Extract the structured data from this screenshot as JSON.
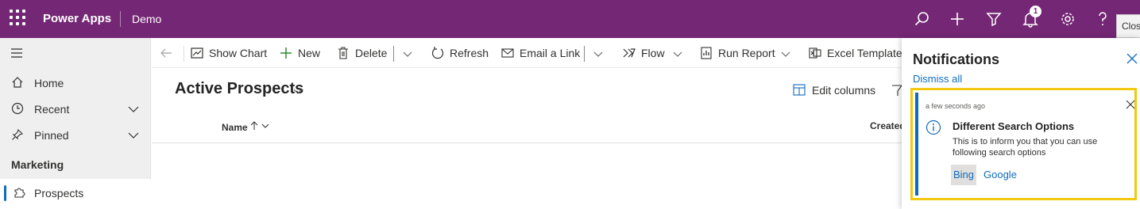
{
  "topbar": {
    "app_name": "Power Apps",
    "environment": "Demo",
    "notification_count": "1",
    "close_tooltip": "Clos",
    "icons": [
      "search-icon",
      "plus-icon",
      "filter-icon",
      "bell-icon",
      "gear-icon",
      "help-icon"
    ],
    "background_color": "#742774"
  },
  "sidebar": {
    "items": [
      {
        "label": "Home",
        "icon": "home-icon"
      },
      {
        "label": "Recent",
        "icon": "clock-icon",
        "expandable": true
      },
      {
        "label": "Pinned",
        "icon": "pin-icon",
        "expandable": true
      }
    ],
    "group_label": "Marketing",
    "active_item": {
      "label": "Prospects",
      "icon": "puzzle-icon"
    }
  },
  "commandbar": {
    "show_chart": "Show Chart",
    "new": "New",
    "delete": "Delete",
    "refresh": "Refresh",
    "email_link": "Email a Link",
    "flow": "Flow",
    "run_report": "Run Report",
    "excel_templates": "Excel Templates"
  },
  "view": {
    "title": "Active Prospects",
    "edit_columns": "Edit columns",
    "columns": {
      "name": "Name",
      "created": "Created"
    }
  },
  "notifications": {
    "title": "Notifications",
    "dismiss_all": "Dismiss all",
    "card": {
      "time": "a few seconds ago",
      "heading": "Different Search Options",
      "body": "This is to inform you that you can use following search options",
      "actions": [
        "Bing",
        "Google"
      ]
    },
    "highlight_color": "#f2c811",
    "accent_color": "#0f6cbd"
  }
}
